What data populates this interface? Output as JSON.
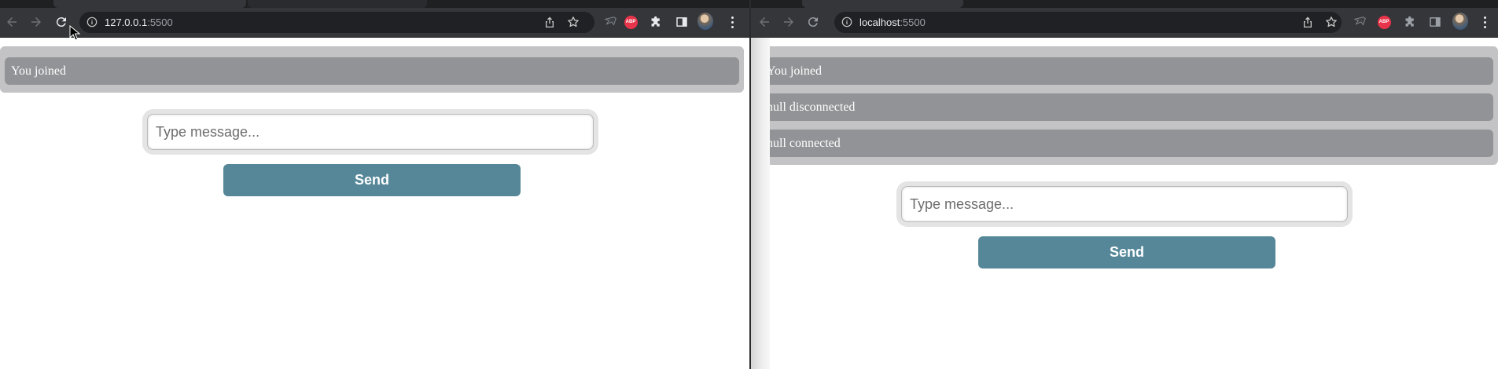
{
  "left_window": {
    "url": {
      "host": "127.0.0.1",
      "port": ":5500"
    },
    "messages": [
      "You joined"
    ],
    "input": {
      "placeholder": "Type message...",
      "value": ""
    },
    "send_label": "Send"
  },
  "right_window": {
    "url": {
      "host": "localhost",
      "port": ":5500"
    },
    "messages": [
      "You joined",
      "null disconnected",
      "null connected"
    ],
    "input": {
      "placeholder": "Type message...",
      "value": ""
    },
    "send_label": "Send"
  },
  "extensions": {
    "abp_label": "ABP"
  },
  "icons": [
    "back-icon",
    "forward-icon",
    "reload-icon",
    "info-icon",
    "share-icon",
    "star-icon",
    "extension-icon",
    "abp-icon",
    "puzzle-icon",
    "sidepanel-icon",
    "avatar",
    "kebab-menu-icon"
  ],
  "colors": {
    "send_button": "#558799",
    "message_bubble": "#929396",
    "messages_panel": "#c3c3c5",
    "toolbar": "#35363a",
    "omnibox": "#202124"
  }
}
